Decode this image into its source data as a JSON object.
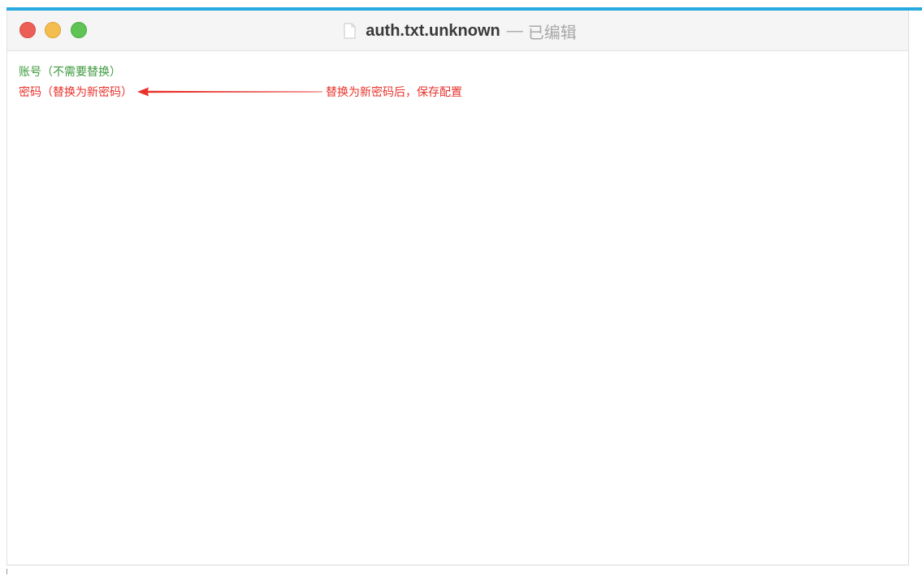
{
  "window": {
    "title": "auth.txt.unknown",
    "separator": "—",
    "status": "已编辑"
  },
  "document": {
    "lines": [
      {
        "text": "账号（不需要替换）",
        "color": "#3e9a3e"
      },
      {
        "text": "密码（替换为新密码）",
        "color": "#e8332c"
      }
    ]
  },
  "annotation": {
    "text": "替换为新密码后，保存配置",
    "color": "#e8332c"
  },
  "colors": {
    "accent": "#29a8e0",
    "close": "#ec5f57",
    "minimize": "#f4bd4f",
    "zoom": "#5fc454"
  }
}
